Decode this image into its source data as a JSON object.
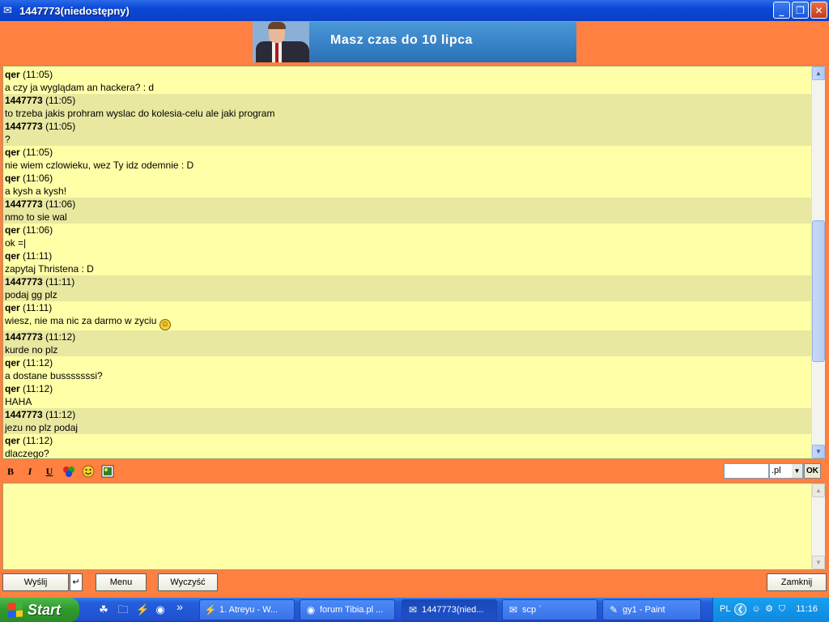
{
  "window": {
    "title": "1447773(niedostępny)",
    "icon": "envelope-icon"
  },
  "window_controls": {
    "minimize": "_",
    "restore": "❐",
    "close": "✕"
  },
  "banner": {
    "text": "Masz czas do 10 lipca"
  },
  "messages": [
    {
      "nick": "qer",
      "time": "(11:05)",
      "text": "a czy ja wyglądam an hackera? : d",
      "alt": false
    },
    {
      "nick": "1447773",
      "time": "(11:05)",
      "text": "to trzeba jakis prohram wyslac do kolesia-celu ale jaki program",
      "alt": true
    },
    {
      "nick": "1447773",
      "time": "(11:05)",
      "text": "?",
      "alt": true
    },
    {
      "nick": "qer",
      "time": "(11:05)",
      "text": "nie wiem czlowieku, wez Ty idz odemnie : D",
      "alt": false
    },
    {
      "nick": "qer",
      "time": "(11:06)",
      "text": "a kysh a kysh!",
      "alt": false
    },
    {
      "nick": "1447773",
      "time": "(11:06)",
      "text": "nmo to sie wal",
      "alt": true
    },
    {
      "nick": "qer",
      "time": "(11:06)",
      "text": "ok =|",
      "alt": false
    },
    {
      "nick": "qer",
      "time": "(11:11)",
      "text": "zapytaj Thristena : D",
      "alt": false
    },
    {
      "nick": "1447773",
      "time": "(11:11)",
      "text": "podaj gg plz",
      "alt": true
    },
    {
      "nick": "qer",
      "time": "(11:11)",
      "text": "wiesz, nie ma nic za darmo w zyciu",
      "alt": false,
      "emoji": "😄"
    },
    {
      "nick": "1447773",
      "time": "(11:12)",
      "text": "kurde no plz",
      "alt": true
    },
    {
      "nick": "qer",
      "time": "(11:12)",
      "text": "a dostane busssssssi?",
      "alt": false
    },
    {
      "nick": "qer",
      "time": "(11:12)",
      "text": "HAHA",
      "alt": false
    },
    {
      "nick": "1447773",
      "time": "(11:12)",
      "text": "jezu no plz podaj",
      "alt": true
    },
    {
      "nick": "qer",
      "time": "(11:12)",
      "text": "dlaczego?",
      "alt": false
    }
  ],
  "format_toolbar": {
    "bold": "B",
    "italic": "I",
    "underline": "U",
    "color": "color-icon",
    "emoticon": "smiley-icon",
    "image": "image-icon"
  },
  "domain": {
    "input_value": "",
    "selected": ".pl",
    "ok_label": "OK"
  },
  "input": {
    "value": ""
  },
  "buttons": {
    "send": "Wyślij",
    "enter_toggle": "↵",
    "menu": "Menu",
    "clear": "Wyczyść",
    "close": "Zamknij"
  },
  "taskbar": {
    "start_label": "Start",
    "quicklaunch_more": "»",
    "tasks": [
      {
        "label": "1. Atreyu - W...",
        "icon": "winamp-icon"
      },
      {
        "label": "forum Tibia.pl ...",
        "icon": "firefox-icon"
      },
      {
        "label": "1447773(nied...",
        "icon": "envelope-icon"
      },
      {
        "label": "scp `",
        "icon": "envelope-icon"
      },
      {
        "label": "gy1 - Paint",
        "icon": "paint-icon"
      }
    ],
    "tray": {
      "language": "PL",
      "clock": "11:16"
    }
  }
}
